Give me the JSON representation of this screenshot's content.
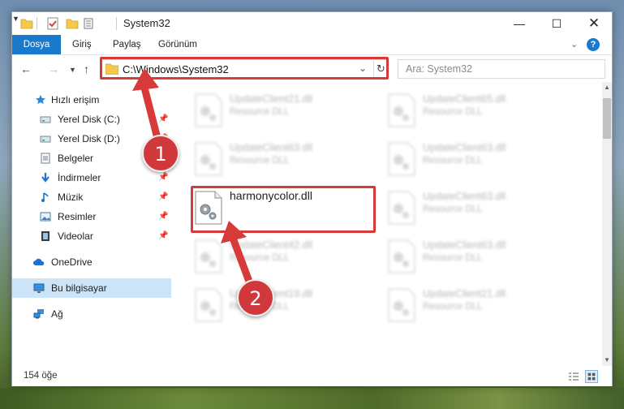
{
  "window": {
    "title": "System32",
    "controls": {
      "minimize": "—",
      "maximize": "☐",
      "close": "✕"
    }
  },
  "ribbon": {
    "tabs": [
      "Dosya",
      "Giriş",
      "Paylaş",
      "Görünüm"
    ],
    "help_glyph": "?",
    "expand_glyph": "⌄"
  },
  "address": {
    "path": "C:\\Windows\\System32",
    "search_placeholder": "Ara: System32"
  },
  "sidebar": {
    "items": [
      {
        "label": "Hızlı erişim",
        "icon": "star-icon"
      },
      {
        "label": "Yerel Disk (C:)",
        "icon": "drive-icon",
        "pinned": true
      },
      {
        "label": "Yerel Disk (D:)",
        "icon": "drive-icon",
        "pinned": true
      },
      {
        "label": "Belgeler",
        "icon": "documents-icon",
        "pinned": true
      },
      {
        "label": "İndirmeler",
        "icon": "download-icon",
        "pinned": true
      },
      {
        "label": "Müzik",
        "icon": "music-icon",
        "pinned": true
      },
      {
        "label": "Resimler",
        "icon": "pictures-icon",
        "pinned": true
      },
      {
        "label": "Videolar",
        "icon": "video-icon",
        "pinned": true
      },
      {
        "label": "OneDrive",
        "icon": "cloud-icon"
      },
      {
        "label": "Bu bilgisayar",
        "icon": "computer-icon",
        "selected": true
      },
      {
        "label": "Ağ",
        "icon": "network-icon"
      }
    ],
    "pin_glyph": "📌"
  },
  "files": {
    "focus": {
      "name": "harmonycolor.dll"
    },
    "left_column": [
      {
        "name": "UpdateClient21.dll",
        "type": "Resource DLL"
      },
      {
        "name": "UpdateClient63.dll",
        "type": "Resource DLL"
      },
      {
        "name": "UpdateClient42.dll",
        "type": "Resource DLL"
      },
      {
        "name": "UpdateClient19.dll",
        "type": "Resource DLL"
      }
    ],
    "right_column": [
      {
        "name": "UpdateClient65.dll",
        "type": "Resource DLL"
      },
      {
        "name": "UpdateClient63.dll",
        "type": "Resource DLL"
      },
      {
        "name": "UpdateClient63.dll",
        "type": "Resource DLL"
      },
      {
        "name": "UpdateClient63.dll",
        "type": "Resource DLL"
      },
      {
        "name": "UpdateClient21.dll",
        "type": "Resource DLL"
      }
    ]
  },
  "status": {
    "count": "154 öğe"
  },
  "annotations": {
    "step1": "1",
    "step2": "2",
    "color": "#d83a3a"
  }
}
